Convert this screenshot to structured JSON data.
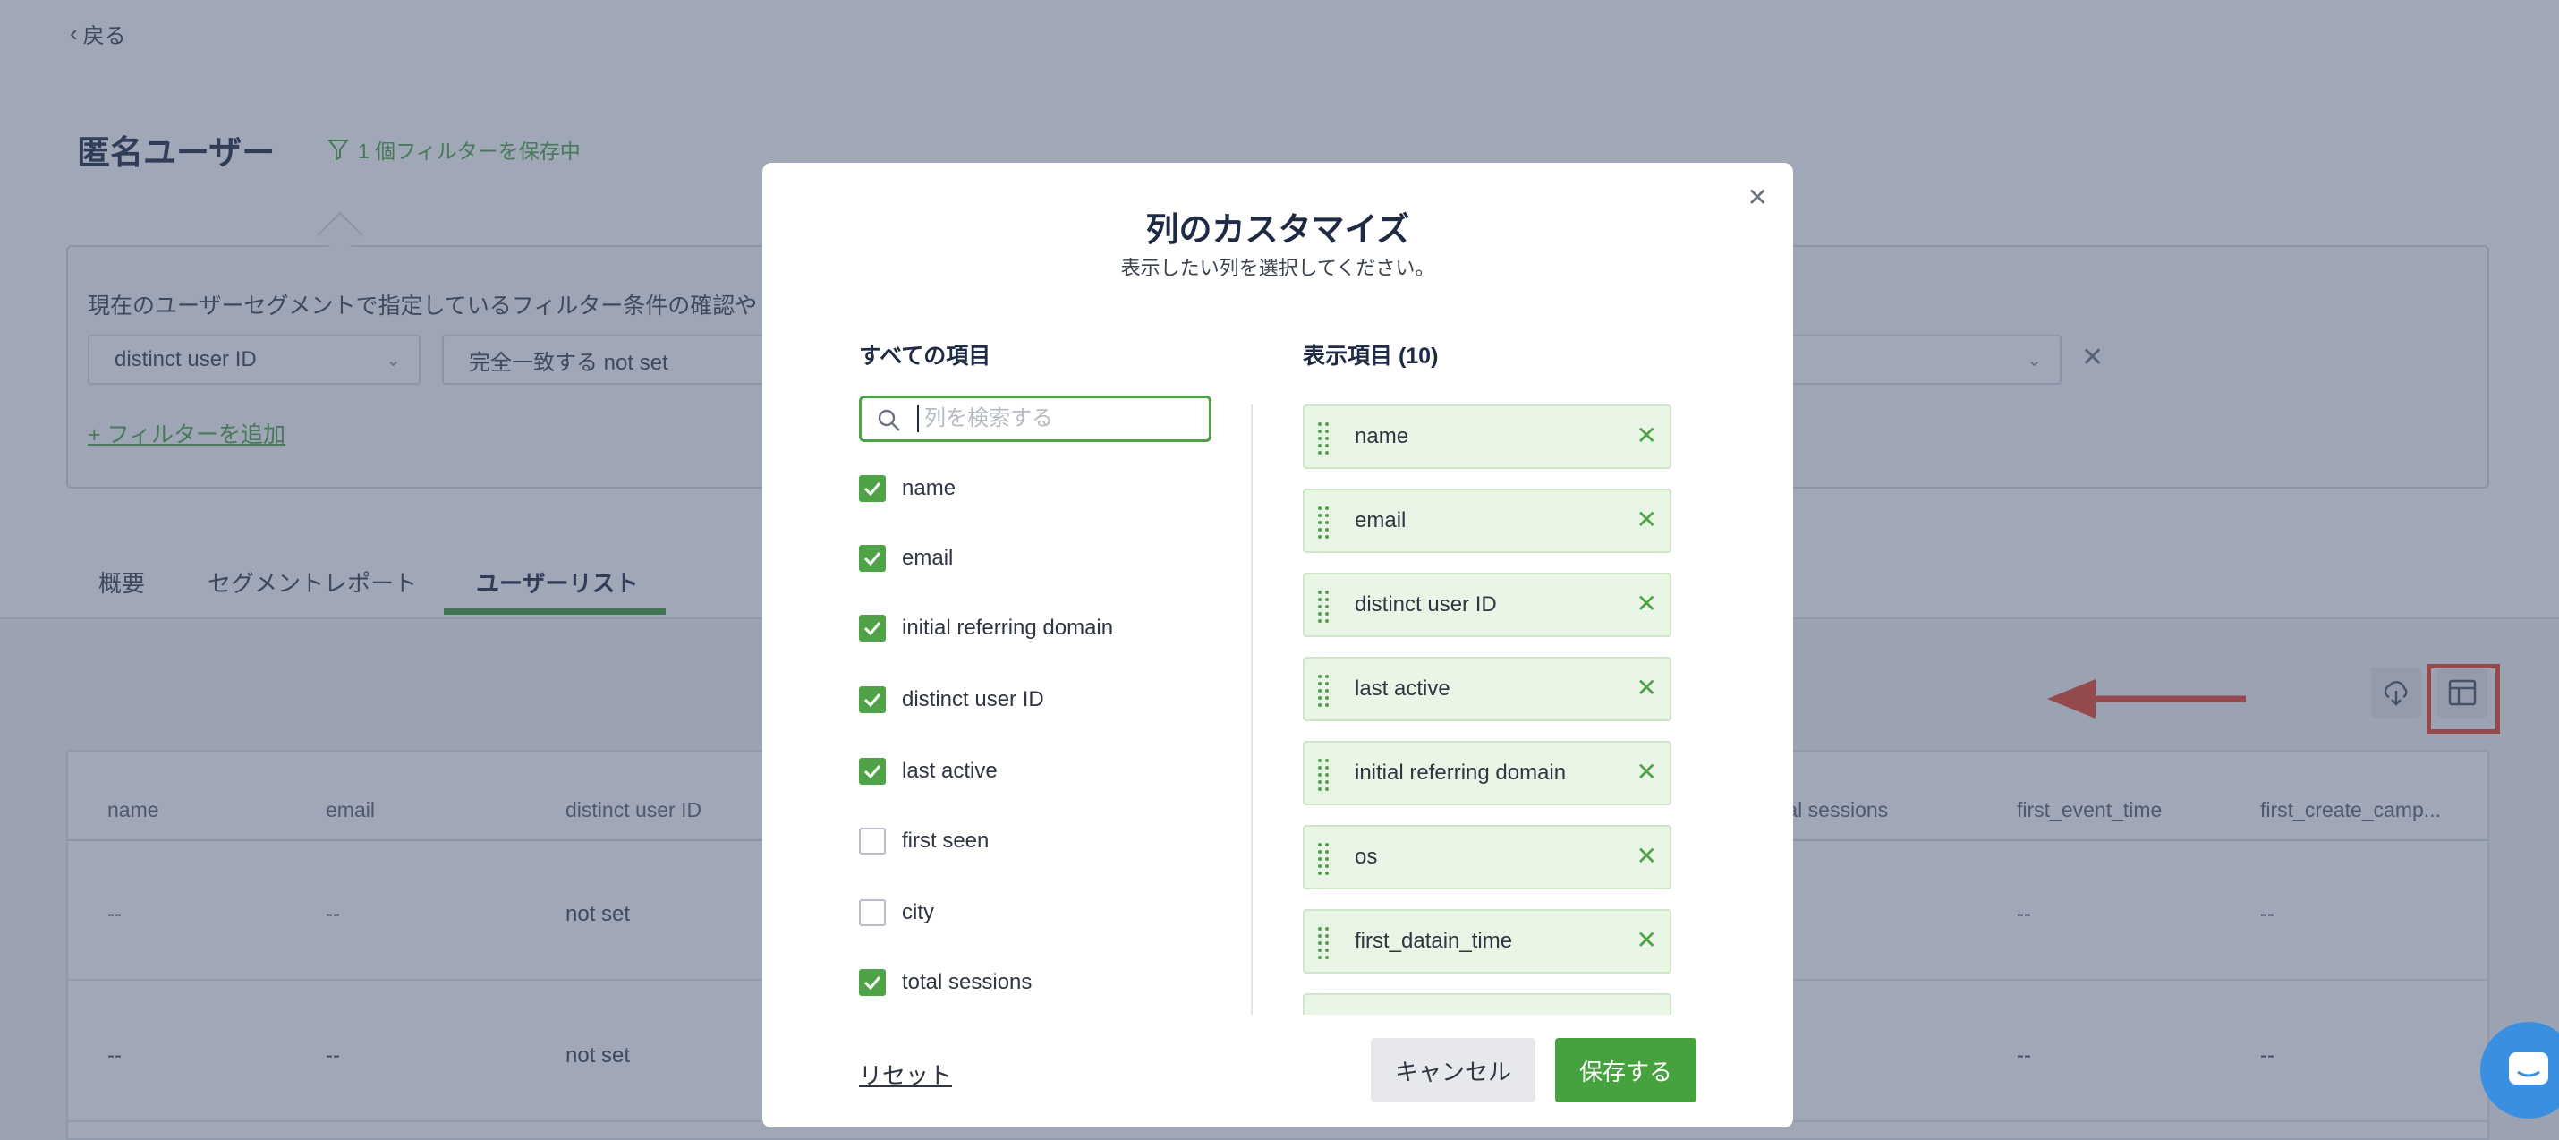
{
  "header": {
    "back_label": "戻る",
    "title": "匿名ユーザー",
    "saved_filter": "1 個フィルターを保存中"
  },
  "filter": {
    "description": "現在のユーザーセグメントで指定しているフィルター条件の確認や",
    "field": "distinct user ID",
    "operator": "完全一致する not set",
    "add_filter": "+ フィルターを追加"
  },
  "tabs": [
    {
      "label": "概要"
    },
    {
      "label": "セグメントレポート"
    },
    {
      "label": "ユーザーリスト"
    }
  ],
  "table": {
    "columns": [
      "name",
      "email",
      "distinct user ID",
      "tal sessions",
      "first_event_time",
      "first_create_camp..."
    ],
    "rows": [
      {
        "name": "--",
        "email": "--",
        "id": "not set",
        "c4": "--",
        "c5": "--"
      },
      {
        "name": "--",
        "email": "--",
        "id": "not set",
        "c4": "--",
        "c5": "--"
      }
    ]
  },
  "modal": {
    "title": "列のカスタマイズ",
    "subtitle": "表示したい列を選択してください。",
    "all_items_heading": "すべての項目",
    "search_placeholder": "列を検索する",
    "shown_heading": "表示項目 (10)",
    "all_items": [
      {
        "label": "name",
        "checked": true
      },
      {
        "label": "email",
        "checked": true
      },
      {
        "label": "initial referring domain",
        "checked": true
      },
      {
        "label": "distinct user ID",
        "checked": true
      },
      {
        "label": "last active",
        "checked": true
      },
      {
        "label": "first seen",
        "checked": false
      },
      {
        "label": "city",
        "checked": false
      },
      {
        "label": "total sessions",
        "checked": true
      }
    ],
    "selected_items": [
      {
        "label": "name"
      },
      {
        "label": "email"
      },
      {
        "label": "distinct user ID"
      },
      {
        "label": "last active"
      },
      {
        "label": "initial referring domain"
      },
      {
        "label": "os"
      },
      {
        "label": "first_datain_time"
      }
    ],
    "reset": "リセット",
    "cancel": "キャンセル",
    "save": "保存する"
  },
  "colors": {
    "accent": "#4ea346",
    "highlight": "#e6432c",
    "chat": "#3b8fe0"
  }
}
